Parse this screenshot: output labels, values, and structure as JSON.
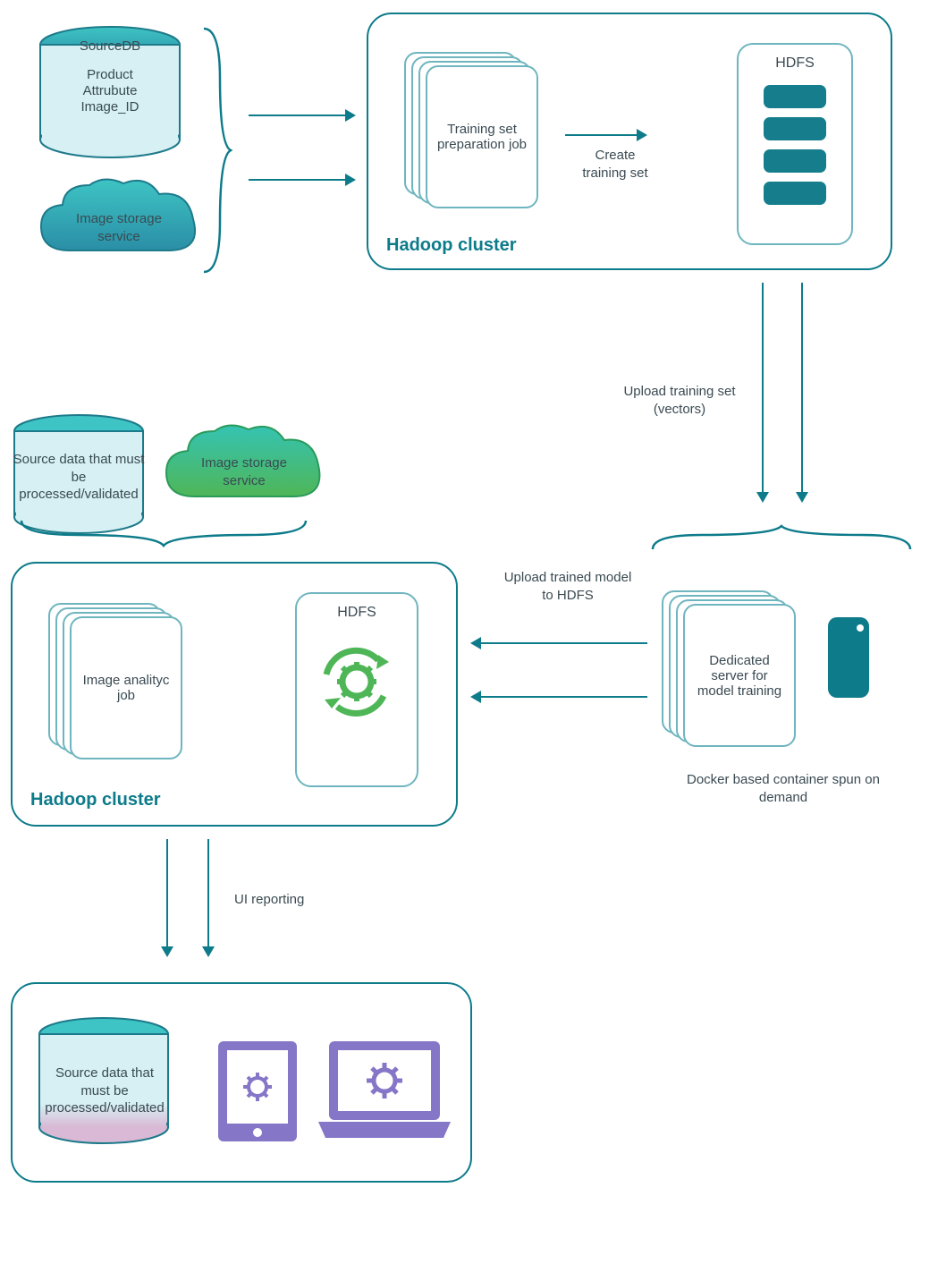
{
  "sourceDB": {
    "title": "SourceDB",
    "line1": "Product",
    "line2": "Attrubute",
    "line3": "Image_ID"
  },
  "imageStorage": {
    "label": "Image storage service"
  },
  "hadoop1": {
    "title": "Hadoop cluster",
    "job": "Training set preparation job",
    "hdfsTitle": "HDFS",
    "arrowLabel": "Create training set"
  },
  "uploadTraining": "Upload training set (vectors)",
  "dedicatedServer": {
    "label": "Dedicated server for model training",
    "caption": "Docker based container spun on demand"
  },
  "uploadModel": "Upload trained model to HDFS",
  "sourceData": {
    "label": "Source data that must be processed/validated"
  },
  "imageStorage2": {
    "label": "Image storage service"
  },
  "hadoop2": {
    "title": "Hadoop cluster",
    "job": "Image analityc job",
    "hdfsTitle": "HDFS"
  },
  "uiReporting": "UI reporting",
  "bottomSource": {
    "label": "Source data that must be processed/validated"
  },
  "colors": {
    "teal": "#0d7b8a",
    "tealLight": "#6fb5bf",
    "green": "#4fb657",
    "purple": "#8576c7"
  }
}
